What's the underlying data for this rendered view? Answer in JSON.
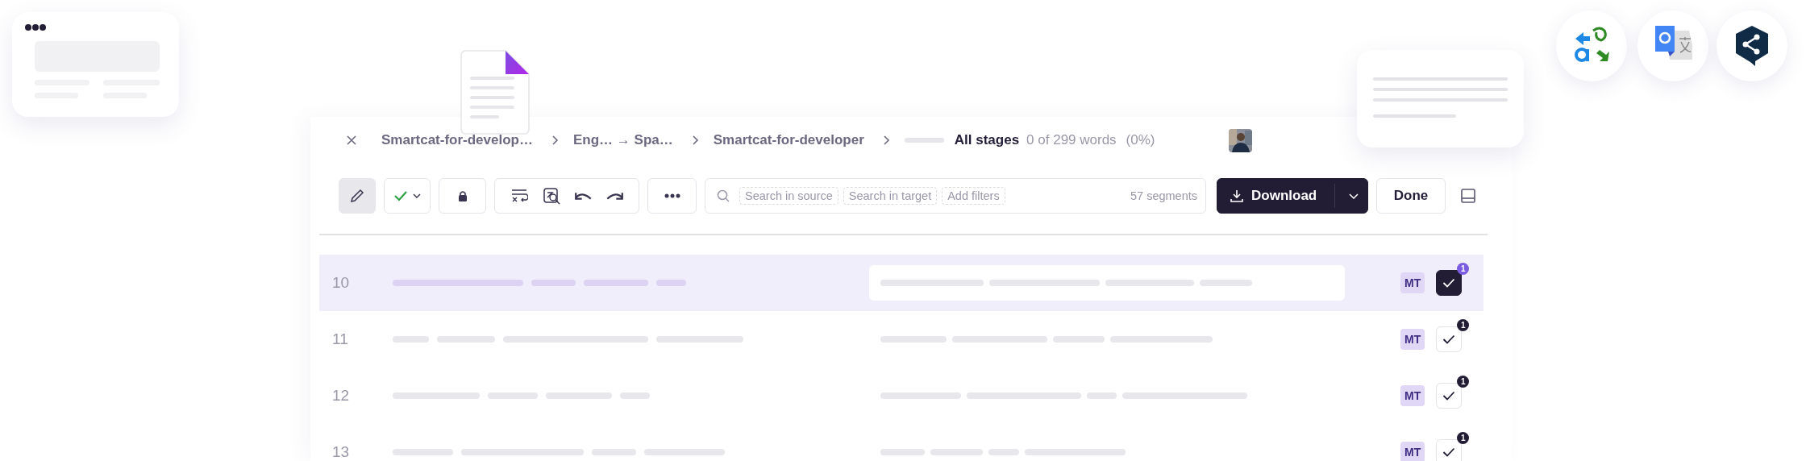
{
  "breadcrumbs": [
    {
      "text": "Smartcat-for-develop…"
    },
    {
      "text": "Eng… → Spa…"
    },
    {
      "text": "Smartcat-for-developer"
    }
  ],
  "progress": {
    "level": 0
  },
  "stage": "All stages",
  "word_count": "0 of 299 words",
  "percent": "(0%)",
  "toolbar": {
    "edit_selected": true,
    "search_chips": [
      "Search in source",
      "Search in target",
      "Add filters"
    ],
    "segments": "57 segments",
    "download": "Download",
    "done": "Done"
  },
  "rows": [
    {
      "number": "10",
      "selected": true,
      "badge": "MT",
      "checked": true,
      "count": "1"
    },
    {
      "number": "11",
      "selected": false,
      "badge": "MT",
      "checked": true,
      "count": "1"
    },
    {
      "number": "12",
      "selected": false,
      "badge": "MT",
      "checked": true,
      "count": "1"
    },
    {
      "number": "13",
      "selected": false,
      "badge": "MT",
      "checked": true,
      "count": "1"
    }
  ]
}
